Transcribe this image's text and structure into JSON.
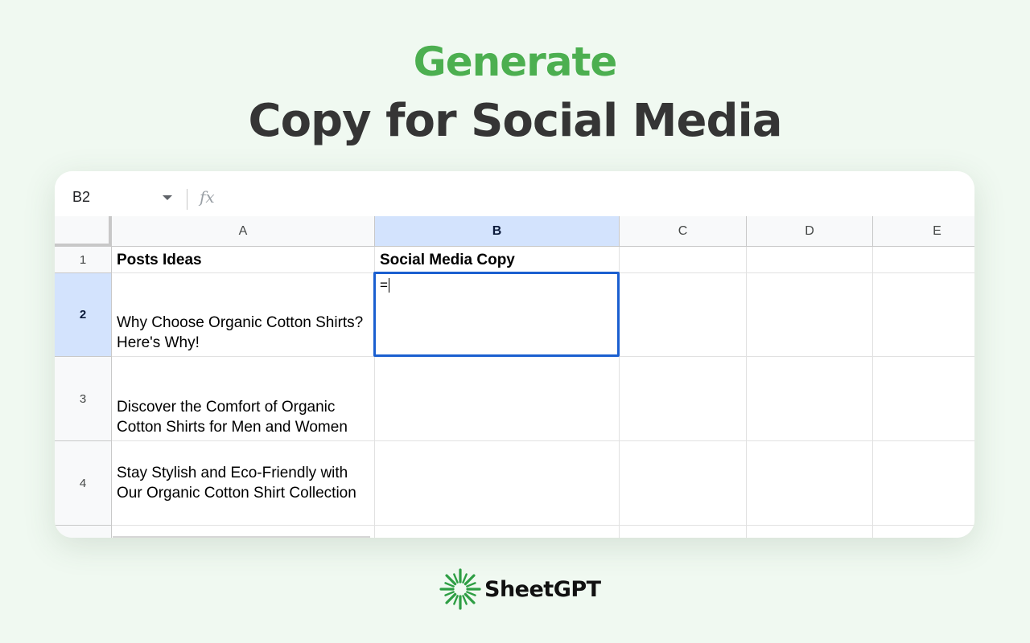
{
  "headline": {
    "line1": "Generate",
    "line2": "Copy for Social Media"
  },
  "formula_bar": {
    "cell_reference": "B2",
    "fx_label": "fx",
    "icon": "fx-icon"
  },
  "columns": [
    {
      "label": "A",
      "selected": false
    },
    {
      "label": "B",
      "selected": true
    },
    {
      "label": "C",
      "selected": false
    },
    {
      "label": "D",
      "selected": false
    },
    {
      "label": "E",
      "selected": false
    }
  ],
  "rows": [
    {
      "number": "1",
      "a": "Posts Ideas",
      "b": "Social Media Copy",
      "selected": false
    },
    {
      "number": "2",
      "a": "Why Choose Organic Cotton Shirts? Here's Why!",
      "b": "",
      "selected": true
    },
    {
      "number": "3",
      "a": "Discover the Comfort of Organic Cotton Shirts for Men and Women",
      "b": "",
      "selected": false
    },
    {
      "number": "4",
      "a": "Stay Stylish and Eco-Friendly with Our Organic Cotton Shirt Collection",
      "b": "",
      "selected": false
    }
  ],
  "active_cell": {
    "ref": "B2",
    "input_value": "="
  },
  "brand": {
    "name": "SheetGPT",
    "logo_icon": "sheetgpt-logo-icon"
  },
  "colors": {
    "background": "#f0f9f1",
    "headline_green": "#4caf50",
    "headline_dark": "#353535",
    "selection_blue": "#1a5fd0",
    "header_selected": "#d3e3fd",
    "brand_green": "#2e9e44"
  }
}
